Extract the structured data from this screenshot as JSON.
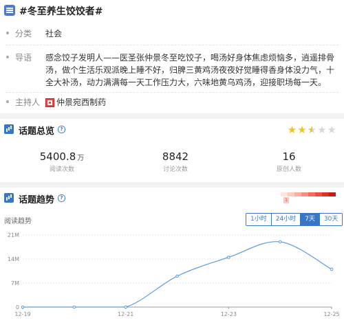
{
  "topic": {
    "title": "#冬至养生饺饺者#"
  },
  "info": {
    "category_label": "分类",
    "category_value": "社会",
    "intro_label": "导语",
    "intro_text": "感念饺子发明人——医圣张仲景冬至吃饺子，喝汤好身体焦虑烦恼多，逍遥排骨汤，做个生活乐观派晚上睡不好，归脾三黄鸡汤夜夜好觉睡得香身体没力气，十全大补汤，动力满满每一天工作压力大，六味地黄乌鸡汤，迎接职场每一天。",
    "host_label": "主持人",
    "host_name": "仲景宛西制药"
  },
  "overview": {
    "title": "话题总览",
    "help": "?",
    "rating": 2.5,
    "read_count": "5400.8",
    "read_unit": "万",
    "read_caption": "阅读次数",
    "discuss_count": "8842",
    "discuss_caption": "讨论次数",
    "origin_count": "16",
    "origin_caption": "原创人数"
  },
  "trend": {
    "title": "话题趋势",
    "help": "?",
    "heat_level": "1",
    "series_label": "阅读趋势",
    "ranges": [
      "1小时",
      "24小时",
      "7天",
      "30天"
    ],
    "active_range": "7天"
  },
  "colors": {
    "accent": "#3a76c8",
    "line": "#5b9bde",
    "star_on": "#f0c419",
    "heat": [
      "#fde4de",
      "#fbcdc2",
      "#f8b0a2",
      "#f49080",
      "#ef6e5e",
      "#e84f41",
      "#d93328",
      "#c21d16"
    ]
  },
  "chart_data": {
    "type": "line",
    "x": [
      "12-19",
      "12-20",
      "12-21",
      "12-22",
      "12-23",
      "12-24",
      "12-25"
    ],
    "xticks": [
      "12-19",
      "12-21",
      "12-23",
      "12-25"
    ],
    "values": [
      0,
      0,
      0,
      9000000,
      14500000,
      19000000,
      11000000
    ],
    "yticks": [
      "0",
      "7M",
      "14M",
      "21M"
    ],
    "ylim": [
      0,
      21000000
    ],
    "grid": true
  }
}
